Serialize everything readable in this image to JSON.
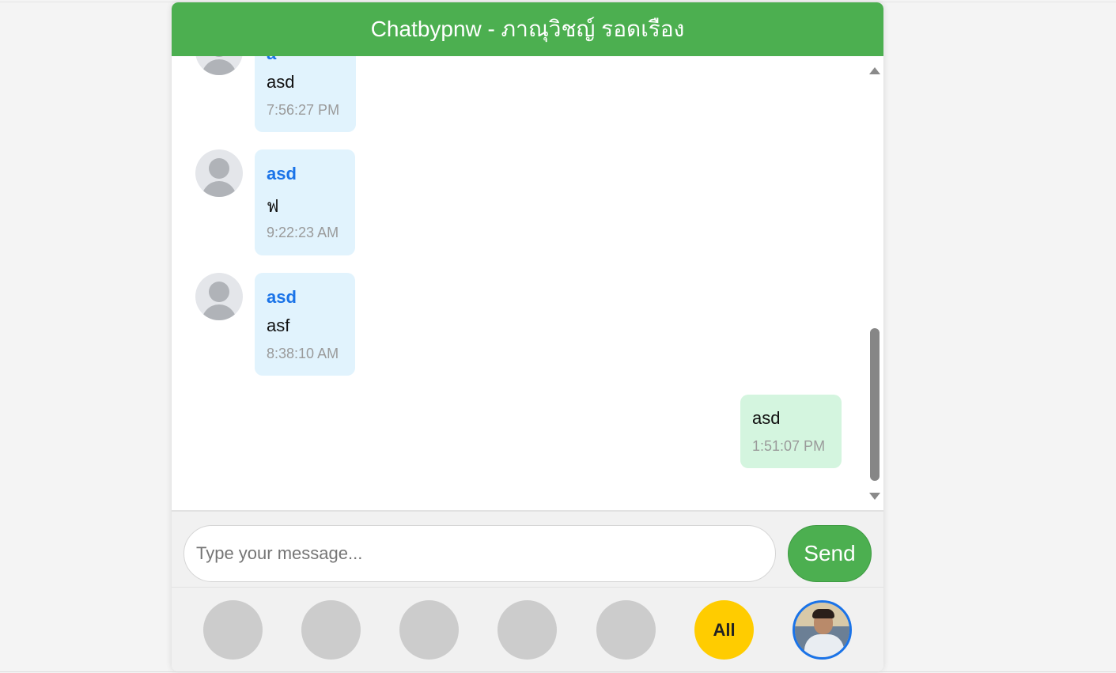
{
  "header": {
    "title": "Chatbypnw - ภาณุวิชญ์ รอดเรือง"
  },
  "messages": [
    {
      "sender": "a",
      "text": "asd",
      "time": "7:56:27 PM",
      "direction": "incoming"
    },
    {
      "sender": "asd",
      "text": "ฟ",
      "time": "9:22:23 AM",
      "direction": "incoming"
    },
    {
      "sender": "asd",
      "text": "asf",
      "time": "8:38:10 AM",
      "direction": "incoming"
    },
    {
      "text": "asd",
      "time": "1:51:07 PM",
      "direction": "outgoing"
    }
  ],
  "input": {
    "placeholder": "Type your message...",
    "value": ""
  },
  "send": {
    "label": "Send"
  },
  "user_bar": {
    "all_label": "All",
    "user_slots": 5
  },
  "colors": {
    "header": "#4caf50",
    "incoming_bubble": "#e1f3fd",
    "outgoing_bubble": "#d4f5df",
    "sender_name": "#1a73e8",
    "all_button": "#ffcc00",
    "self_avatar_ring": "#1a73e8"
  },
  "icons": {
    "avatar": "default-user-avatar-icon",
    "scroll_up": "triangle-up-icon",
    "scroll_down": "triangle-down-icon"
  }
}
